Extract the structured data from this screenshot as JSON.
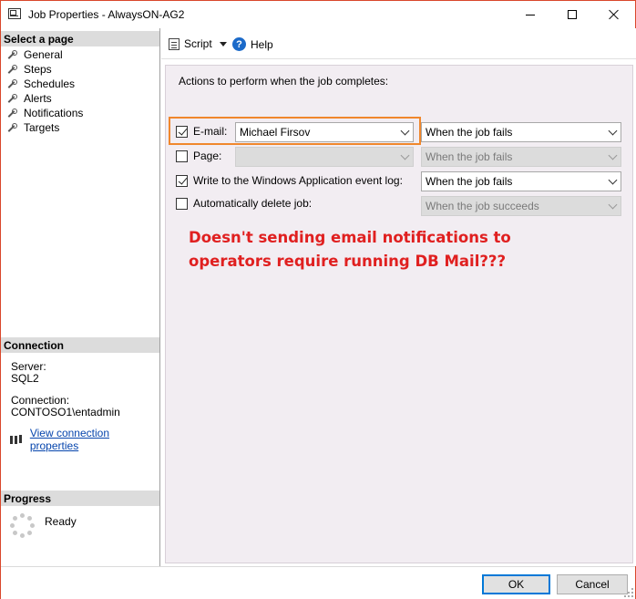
{
  "window": {
    "title": "Job Properties - AlwaysON-AG2"
  },
  "left_pane": {
    "select_page_header": "Select a page",
    "pages": [
      {
        "label": "General"
      },
      {
        "label": "Steps"
      },
      {
        "label": "Schedules"
      },
      {
        "label": "Alerts"
      },
      {
        "label": "Notifications"
      },
      {
        "label": "Targets"
      }
    ],
    "connection_header": "Connection",
    "server_label": "Server:",
    "server_value": "SQL2",
    "connection_label": "Connection:",
    "connection_value": "CONTOSO1\\entadmin",
    "view_connection_link": "View connection properties",
    "progress_header": "Progress",
    "progress_status": "Ready"
  },
  "toolbar": {
    "script_label": "Script",
    "help_label": "Help"
  },
  "notifications": {
    "section_label": "Actions to perform when the job completes:",
    "rows": [
      {
        "label": "E-mail:",
        "checked": true,
        "operator": "Michael Firsov",
        "operator_enabled": true,
        "condition": "When the job fails",
        "condition_enabled": true
      },
      {
        "label": "Page:",
        "checked": false,
        "operator": "",
        "operator_enabled": false,
        "condition": "When the job fails",
        "condition_enabled": false
      },
      {
        "label": "Write to the Windows Application event log:",
        "checked": true,
        "condition": "When the job fails",
        "condition_enabled": true
      },
      {
        "label": "Automatically delete job:",
        "checked": false,
        "condition": "When the job succeeds",
        "condition_enabled": false
      }
    ]
  },
  "annotation": {
    "line1": "Doesn't sending email notifications to",
    "line2": "operators  require running DB Mail???",
    "color": "#e02020"
  },
  "highlight_color": "#f0872c",
  "buttons": {
    "ok": "OK",
    "cancel": "Cancel"
  }
}
